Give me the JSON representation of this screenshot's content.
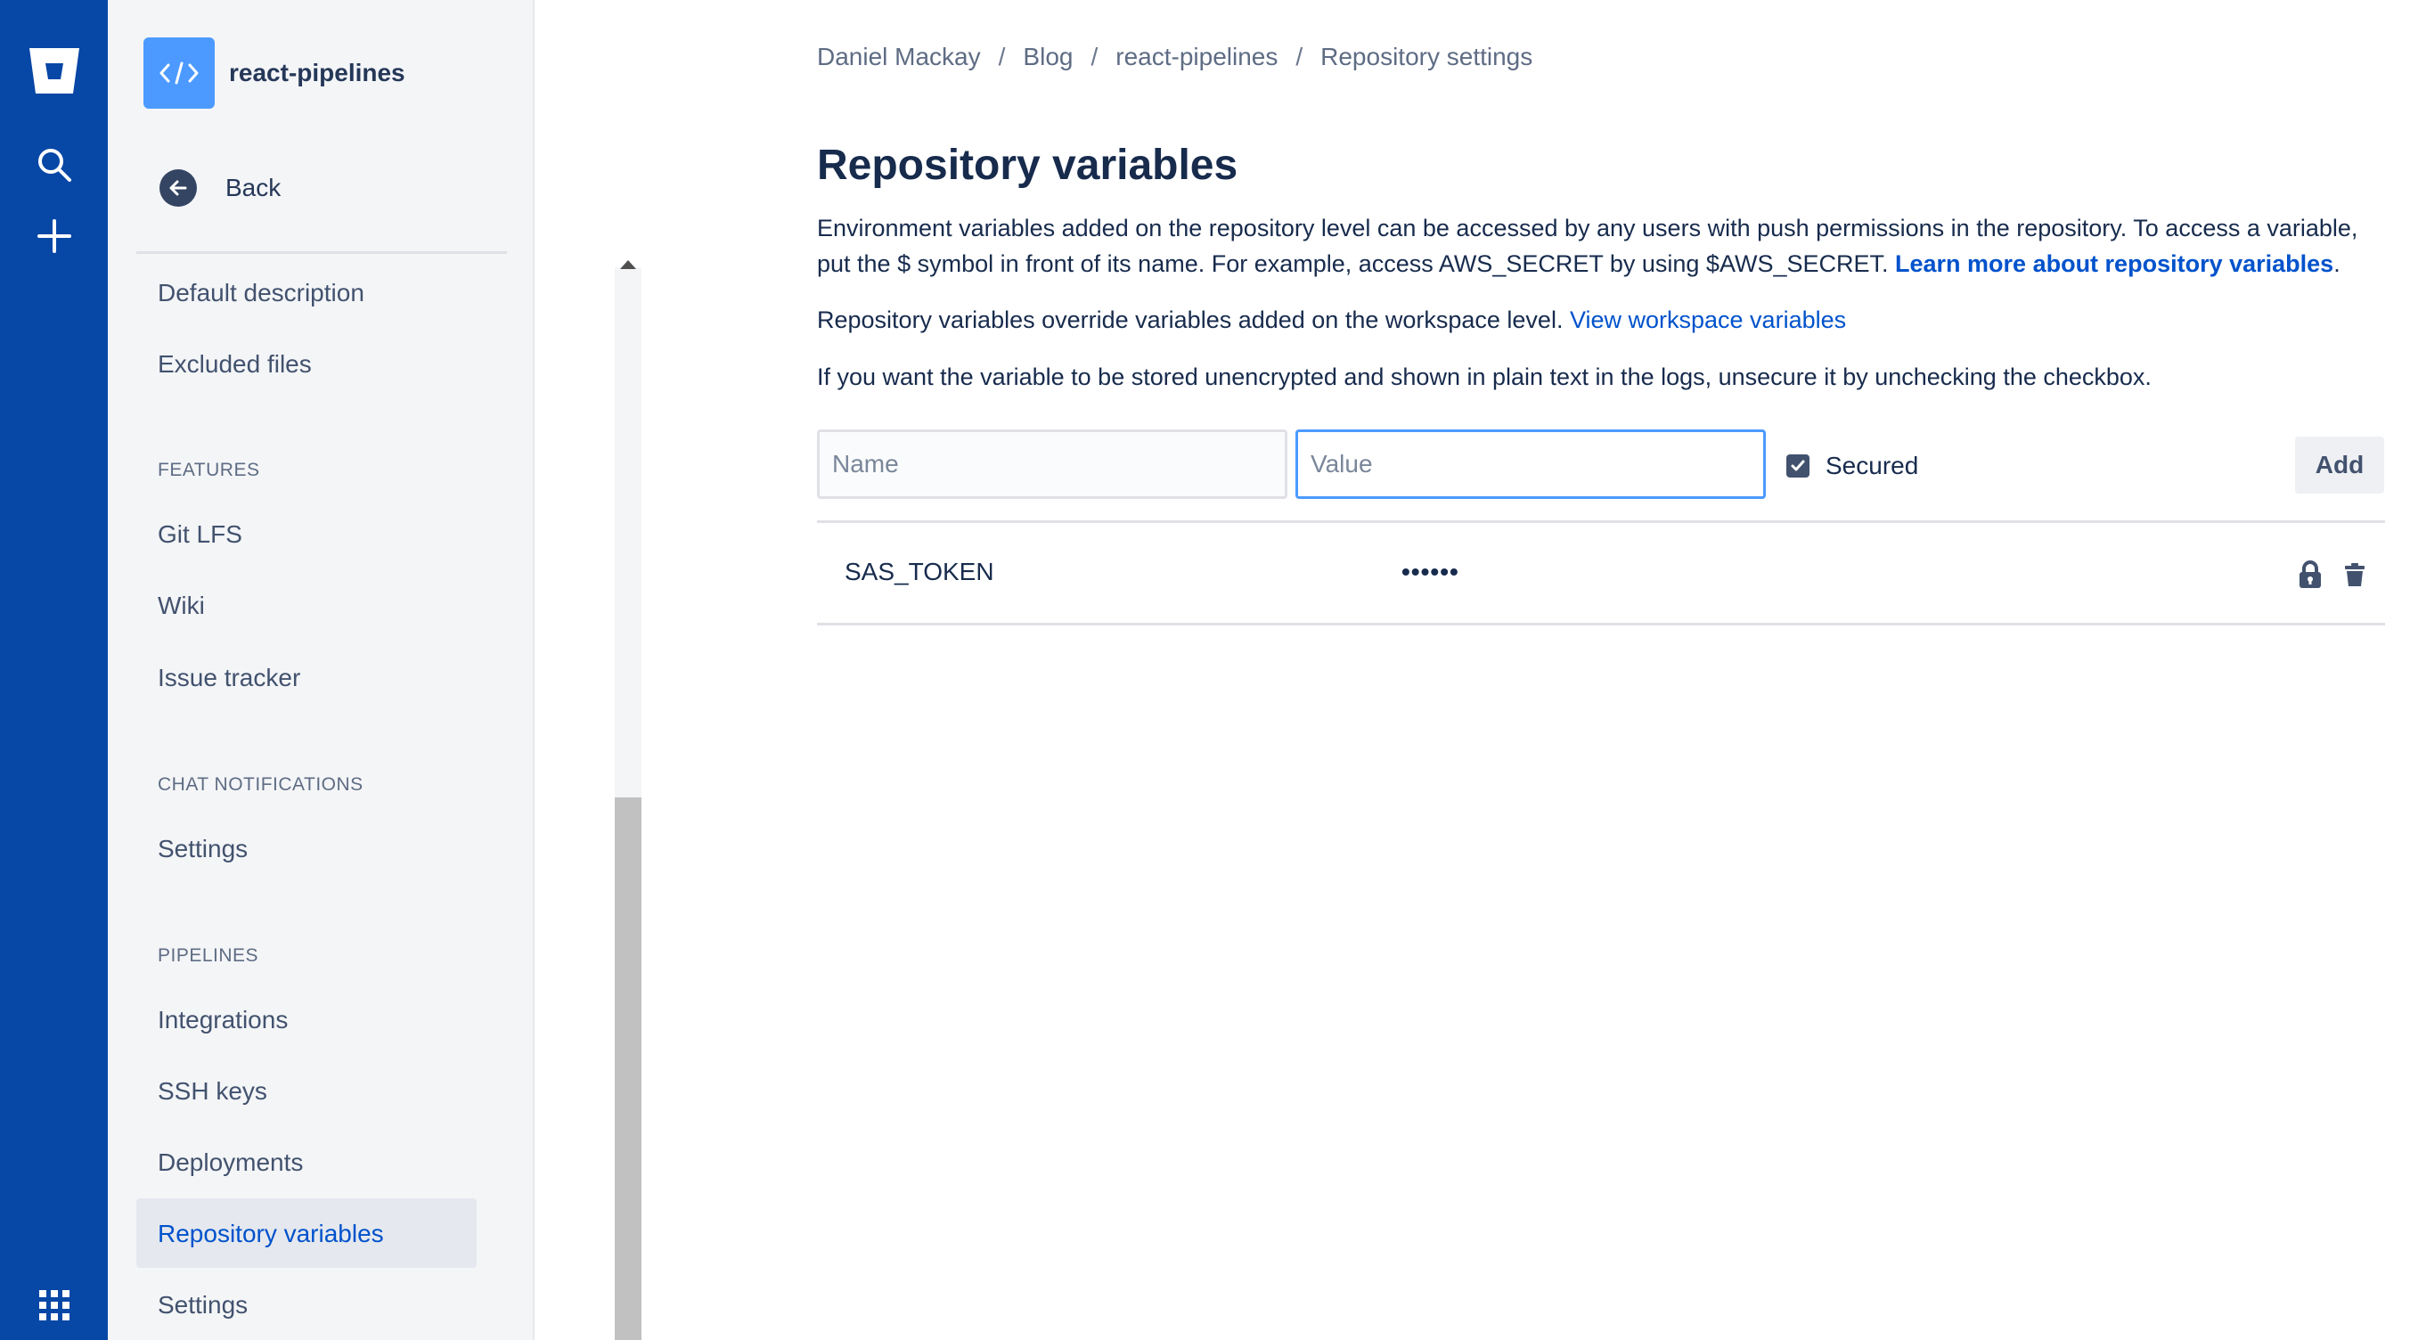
{
  "colors": {
    "global_nav": "#0747a6",
    "sidebar_bg": "#f4f5f7",
    "link": "#0052cc",
    "focus_border": "#4c9aff",
    "text": "#172b4d"
  },
  "global_nav": {
    "icons": [
      "bitbucket-logo-icon",
      "search-icon",
      "plus-icon",
      "app-switcher-icon"
    ]
  },
  "sidebar": {
    "repo_name": "react-pipelines",
    "back_label": "Back",
    "general_items": [
      "Default description",
      "Excluded files"
    ],
    "features_heading": "FEATURES",
    "features_items": [
      "Git LFS",
      "Wiki",
      "Issue tracker"
    ],
    "chat_heading": "CHAT NOTIFICATIONS",
    "chat_items": [
      "Settings"
    ],
    "pipelines_heading": "PIPELINES",
    "pipelines_items": [
      "Integrations",
      "SSH keys",
      "Deployments",
      "Repository variables",
      "Settings"
    ],
    "active_item": "Repository variables"
  },
  "breadcrumb": [
    "Daniel Mackay",
    "Blog",
    "react-pipelines",
    "Repository settings"
  ],
  "breadcrumb_separator": "/",
  "main": {
    "title": "Repository variables",
    "para1_text": "Environment variables added on the repository level can be accessed by any users with push permissions in the repository. To access a variable, put the $ symbol in front of its name. For example, access AWS_SECRET by using $AWS_SECRET.",
    "para1_link": "Learn more about repository variables",
    "para1_end": ".",
    "para2_text": "Repository variables override variables added on the workspace level.",
    "para2_link": "View workspace variables",
    "para3_text": "If you want the variable to be stored unencrypted and shown in plain text in the logs, unsecure it by unchecking the checkbox."
  },
  "form": {
    "name_placeholder": "Name",
    "name_value": "",
    "value_placeholder": "Value",
    "value_value": "",
    "secured_label": "Secured",
    "secured_checked": true,
    "add_label": "Add"
  },
  "variables": [
    {
      "name": "SAS_TOKEN",
      "value": "••••••",
      "secured": true
    }
  ]
}
